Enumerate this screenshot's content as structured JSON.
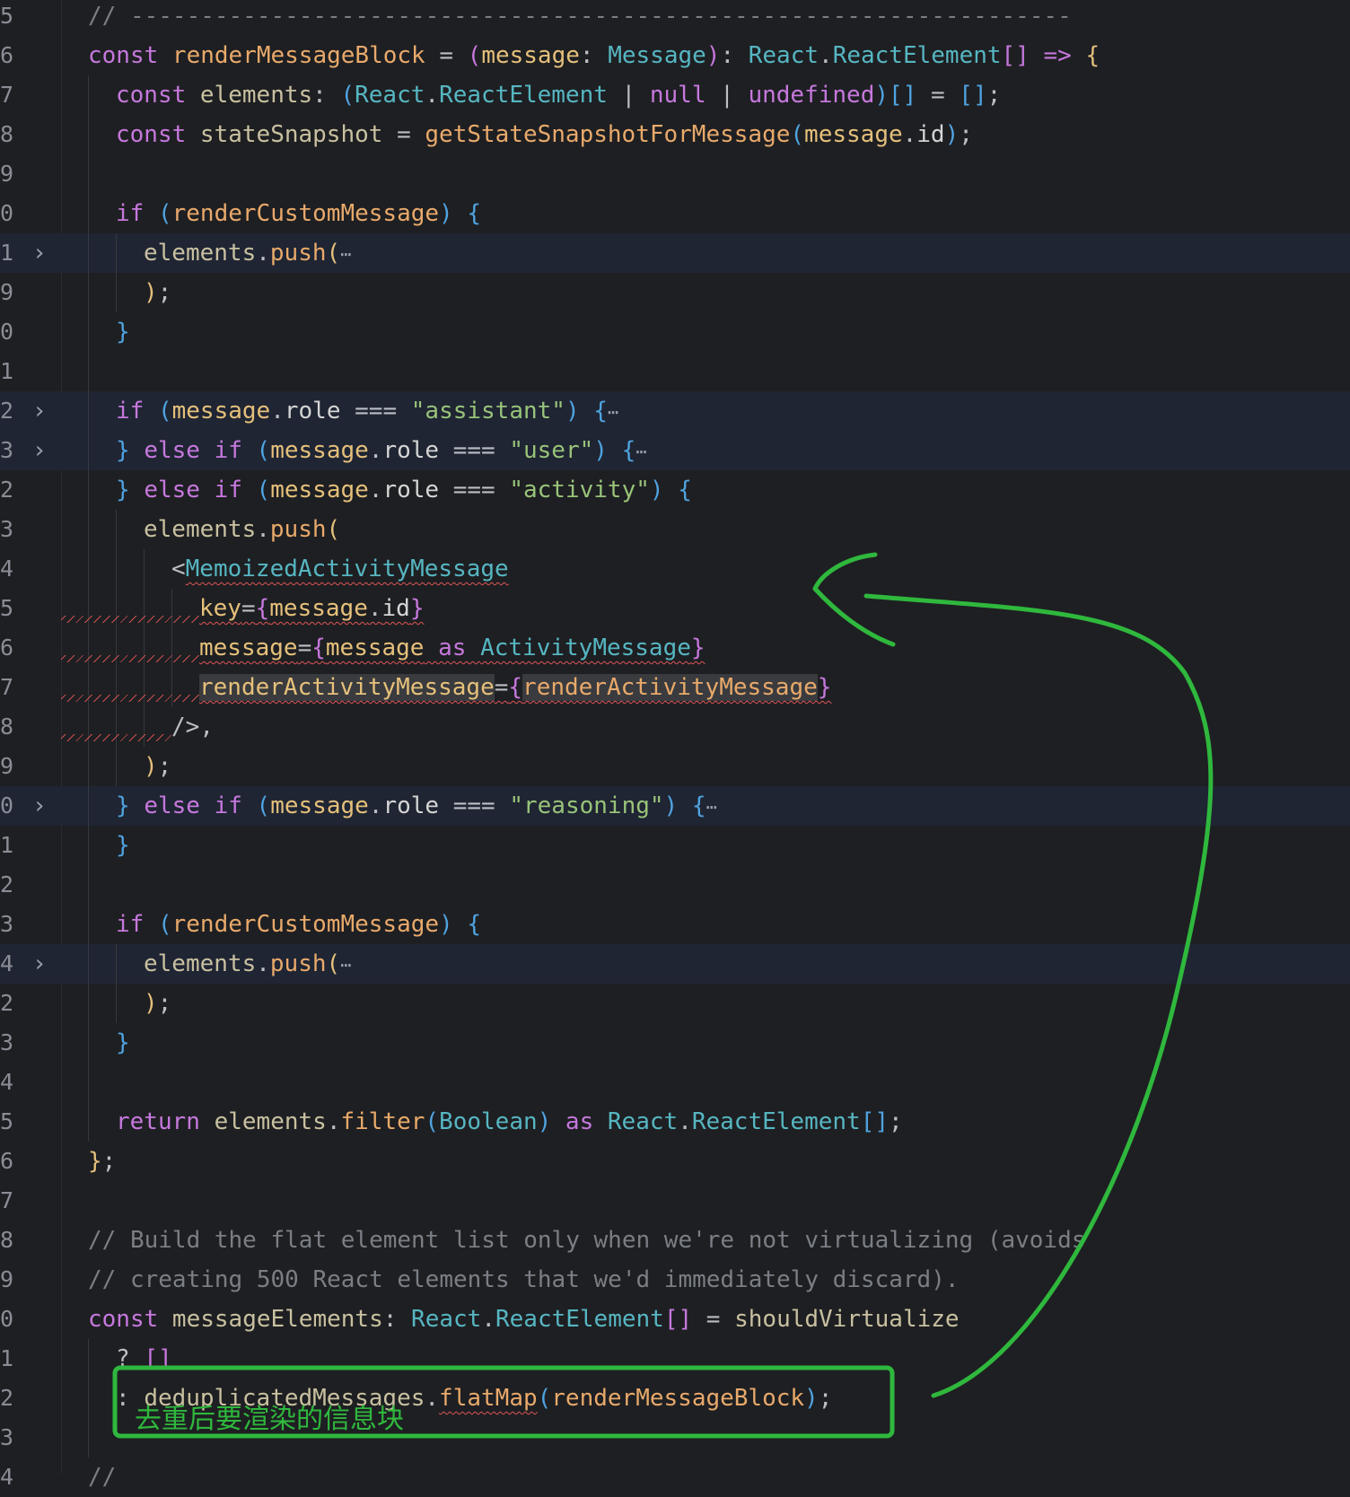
{
  "editor": {
    "lines": [
      {
        "number": "5",
        "folded": false,
        "indent": 1,
        "tokens": [
          {
            "t": "// -------------------------------------------------------------------",
            "c": "cm"
          }
        ]
      },
      {
        "number": "6",
        "folded": false,
        "indent": 1,
        "tokens": [
          {
            "t": "const ",
            "c": "kw"
          },
          {
            "t": "renderMessageBlock",
            "c": "fn"
          },
          {
            "t": " = ",
            "c": "pun"
          },
          {
            "t": "(",
            "c": "br2"
          },
          {
            "t": "message",
            "c": "attr"
          },
          {
            "t": ": ",
            "c": "pun"
          },
          {
            "t": "Message",
            "c": "ty"
          },
          {
            "t": ")",
            "c": "br2"
          },
          {
            "t": ": ",
            "c": "pun"
          },
          {
            "t": "React",
            "c": "ty"
          },
          {
            "t": ".",
            "c": "pun"
          },
          {
            "t": "ReactElement",
            "c": "ty"
          },
          {
            "t": "[]",
            "c": "br2"
          },
          {
            "t": " => ",
            "c": "kw"
          },
          {
            "t": "{",
            "c": "br1"
          }
        ]
      },
      {
        "number": "7",
        "folded": false,
        "indent": 2,
        "tokens": [
          {
            "t": "const ",
            "c": "kw"
          },
          {
            "t": "elements",
            "c": "var"
          },
          {
            "t": ": ",
            "c": "pun"
          },
          {
            "t": "(",
            "c": "br3"
          },
          {
            "t": "React",
            "c": "ty"
          },
          {
            "t": ".",
            "c": "pun"
          },
          {
            "t": "ReactElement",
            "c": "ty"
          },
          {
            "t": " | ",
            "c": "pun"
          },
          {
            "t": "null",
            "c": "kw"
          },
          {
            "t": " | ",
            "c": "pun"
          },
          {
            "t": "undefined",
            "c": "kw"
          },
          {
            "t": ")",
            "c": "br3"
          },
          {
            "t": "[]",
            "c": "br3"
          },
          {
            "t": " = ",
            "c": "pun"
          },
          {
            "t": "[]",
            "c": "br3"
          },
          {
            "t": ";",
            "c": "pun"
          }
        ]
      },
      {
        "number": "8",
        "folded": false,
        "indent": 2,
        "tokens": [
          {
            "t": "const ",
            "c": "kw"
          },
          {
            "t": "stateSnapshot",
            "c": "var"
          },
          {
            "t": " = ",
            "c": "pun"
          },
          {
            "t": "getStateSnapshotForMessage",
            "c": "fn"
          },
          {
            "t": "(",
            "c": "br3"
          },
          {
            "t": "message",
            "c": "attr"
          },
          {
            "t": ".",
            "c": "pun"
          },
          {
            "t": "id",
            "c": "prop"
          },
          {
            "t": ")",
            "c": "br3"
          },
          {
            "t": ";",
            "c": "pun"
          }
        ]
      },
      {
        "number": "9",
        "folded": false,
        "indent": 2,
        "tokens": []
      },
      {
        "number": "0",
        "folded": false,
        "indent": 2,
        "tokens": [
          {
            "t": "if ",
            "c": "kw"
          },
          {
            "t": "(",
            "c": "br3"
          },
          {
            "t": "renderCustomMessage",
            "c": "fn"
          },
          {
            "t": ")",
            "c": "br3"
          },
          {
            "t": " {",
            "c": "br3"
          }
        ]
      },
      {
        "number": "1",
        "folded": true,
        "indent": 3,
        "tokens": [
          {
            "t": "elements",
            "c": "var"
          },
          {
            "t": ".",
            "c": "pun"
          },
          {
            "t": "push",
            "c": "fn"
          },
          {
            "t": "(",
            "c": "br1"
          },
          {
            "t": "⋯",
            "c": "dots"
          }
        ]
      },
      {
        "number": "9",
        "folded": false,
        "indent": 3,
        "tokens": [
          {
            "t": ")",
            "c": "br1"
          },
          {
            "t": ";",
            "c": "pun"
          }
        ]
      },
      {
        "number": "0",
        "folded": false,
        "indent": 2,
        "tokens": [
          {
            "t": "}",
            "c": "br3"
          }
        ]
      },
      {
        "number": "1",
        "folded": false,
        "indent": 2,
        "tokens": []
      },
      {
        "number": "2",
        "folded": true,
        "indent": 2,
        "tokens": [
          {
            "t": "if ",
            "c": "kw"
          },
          {
            "t": "(",
            "c": "br3"
          },
          {
            "t": "message",
            "c": "attr"
          },
          {
            "t": ".",
            "c": "pun"
          },
          {
            "t": "role",
            "c": "prop"
          },
          {
            "t": " === ",
            "c": "pun"
          },
          {
            "t": "\"assistant\"",
            "c": "str"
          },
          {
            "t": ")",
            "c": "br3"
          },
          {
            "t": " {",
            "c": "br3"
          },
          {
            "t": "⋯",
            "c": "dots"
          }
        ]
      },
      {
        "number": "3",
        "folded": true,
        "indent": 2,
        "tokens": [
          {
            "t": "} ",
            "c": "br3"
          },
          {
            "t": "else if ",
            "c": "kw"
          },
          {
            "t": "(",
            "c": "br3"
          },
          {
            "t": "message",
            "c": "attr"
          },
          {
            "t": ".",
            "c": "pun"
          },
          {
            "t": "role",
            "c": "prop"
          },
          {
            "t": " === ",
            "c": "pun"
          },
          {
            "t": "\"user\"",
            "c": "str"
          },
          {
            "t": ")",
            "c": "br3"
          },
          {
            "t": " {",
            "c": "br3"
          },
          {
            "t": "⋯",
            "c": "dots"
          }
        ]
      },
      {
        "number": "2",
        "folded": false,
        "indent": 2,
        "tokens": [
          {
            "t": "} ",
            "c": "br3"
          },
          {
            "t": "else if ",
            "c": "kw"
          },
          {
            "t": "(",
            "c": "br3"
          },
          {
            "t": "message",
            "c": "attr"
          },
          {
            "t": ".",
            "c": "pun"
          },
          {
            "t": "role",
            "c": "prop"
          },
          {
            "t": " === ",
            "c": "pun"
          },
          {
            "t": "\"activity\"",
            "c": "str"
          },
          {
            "t": ")",
            "c": "br3"
          },
          {
            "t": " {",
            "c": "br3"
          }
        ]
      },
      {
        "number": "3",
        "folded": false,
        "indent": 3,
        "tokens": [
          {
            "t": "elements",
            "c": "var"
          },
          {
            "t": ".",
            "c": "pun"
          },
          {
            "t": "push",
            "c": "fn"
          },
          {
            "t": "(",
            "c": "br1"
          }
        ]
      },
      {
        "number": "4",
        "folded": false,
        "indent": 4,
        "tokens": [
          {
            "t": "<",
            "c": "pun"
          },
          {
            "t": "MemoizedActivityMessage",
            "c": "ty",
            "sq": true
          }
        ]
      },
      {
        "number": "5",
        "folded": false,
        "indent": 5,
        "sqlead": true,
        "tokens": [
          {
            "t": "key",
            "c": "attr",
            "sq": true
          },
          {
            "t": "=",
            "c": "pun",
            "sq": true
          },
          {
            "t": "{",
            "c": "br2",
            "sq": true
          },
          {
            "t": "message",
            "c": "attr",
            "sq": true
          },
          {
            "t": ".",
            "c": "pun",
            "sq": true
          },
          {
            "t": "id",
            "c": "prop",
            "sq": true
          },
          {
            "t": "}",
            "c": "br2",
            "sq": true
          }
        ]
      },
      {
        "number": "6",
        "folded": false,
        "indent": 5,
        "sqlead": true,
        "tokens": [
          {
            "t": "message",
            "c": "attr",
            "sq": true
          },
          {
            "t": "=",
            "c": "pun",
            "sq": true
          },
          {
            "t": "{",
            "c": "br2",
            "sq": true
          },
          {
            "t": "message",
            "c": "attr",
            "sq": true
          },
          {
            "t": " as ",
            "c": "kw",
            "sq": true
          },
          {
            "t": "ActivityMessage",
            "c": "ty",
            "sq": true
          },
          {
            "t": "}",
            "c": "br2",
            "sq": true
          }
        ]
      },
      {
        "number": "7",
        "folded": false,
        "indent": 5,
        "sqlead": true,
        "tokens": [
          {
            "t": "renderActivityMessage",
            "c": "attr",
            "sq": true,
            "hl": true
          },
          {
            "t": "=",
            "c": "pun",
            "sq": true
          },
          {
            "t": "{",
            "c": "br2",
            "sq": true
          },
          {
            "t": "renderActivityMessage",
            "c": "fn",
            "sq": true,
            "hl": true
          },
          {
            "t": "}",
            "c": "br2",
            "sq": true
          }
        ]
      },
      {
        "number": "8",
        "folded": false,
        "indent": 4,
        "sqlead": true,
        "tokens": [
          {
            "t": "/>",
            "c": "pun"
          },
          {
            "t": ",",
            "c": "pun"
          }
        ]
      },
      {
        "number": "9",
        "folded": false,
        "indent": 3,
        "tokens": [
          {
            "t": ")",
            "c": "br1"
          },
          {
            "t": ";",
            "c": "pun"
          }
        ]
      },
      {
        "number": "0",
        "folded": true,
        "indent": 2,
        "tokens": [
          {
            "t": "} ",
            "c": "br3"
          },
          {
            "t": "else if ",
            "c": "kw"
          },
          {
            "t": "(",
            "c": "br3"
          },
          {
            "t": "message",
            "c": "attr"
          },
          {
            "t": ".",
            "c": "pun"
          },
          {
            "t": "role",
            "c": "prop"
          },
          {
            "t": " === ",
            "c": "pun"
          },
          {
            "t": "\"reasoning\"",
            "c": "str"
          },
          {
            "t": ")",
            "c": "br3"
          },
          {
            "t": " {",
            "c": "br3"
          },
          {
            "t": "⋯",
            "c": "dots"
          }
        ]
      },
      {
        "number": "1",
        "folded": false,
        "indent": 2,
        "tokens": [
          {
            "t": "}",
            "c": "br3"
          }
        ]
      },
      {
        "number": "2",
        "folded": false,
        "indent": 2,
        "tokens": []
      },
      {
        "number": "3",
        "folded": false,
        "indent": 2,
        "tokens": [
          {
            "t": "if ",
            "c": "kw"
          },
          {
            "t": "(",
            "c": "br3"
          },
          {
            "t": "renderCustomMessage",
            "c": "fn"
          },
          {
            "t": ")",
            "c": "br3"
          },
          {
            "t": " {",
            "c": "br3"
          }
        ]
      },
      {
        "number": "4",
        "folded": true,
        "indent": 3,
        "tokens": [
          {
            "t": "elements",
            "c": "var"
          },
          {
            "t": ".",
            "c": "pun"
          },
          {
            "t": "push",
            "c": "fn"
          },
          {
            "t": "(",
            "c": "br1"
          },
          {
            "t": "⋯",
            "c": "dots"
          }
        ]
      },
      {
        "number": "2",
        "folded": false,
        "indent": 3,
        "tokens": [
          {
            "t": ")",
            "c": "br1"
          },
          {
            "t": ";",
            "c": "pun"
          }
        ]
      },
      {
        "number": "3",
        "folded": false,
        "indent": 2,
        "tokens": [
          {
            "t": "}",
            "c": "br3"
          }
        ]
      },
      {
        "number": "4",
        "folded": false,
        "indent": 2,
        "tokens": []
      },
      {
        "number": "5",
        "folded": false,
        "indent": 2,
        "tokens": [
          {
            "t": "return ",
            "c": "kw"
          },
          {
            "t": "elements",
            "c": "var"
          },
          {
            "t": ".",
            "c": "pun"
          },
          {
            "t": "filter",
            "c": "fn"
          },
          {
            "t": "(",
            "c": "br3"
          },
          {
            "t": "Boolean",
            "c": "ty"
          },
          {
            "t": ")",
            "c": "br3"
          },
          {
            "t": " as ",
            "c": "kw"
          },
          {
            "t": "React",
            "c": "ty"
          },
          {
            "t": ".",
            "c": "pun"
          },
          {
            "t": "ReactElement",
            "c": "ty"
          },
          {
            "t": "[]",
            "c": "br3"
          },
          {
            "t": ";",
            "c": "pun"
          }
        ]
      },
      {
        "number": "6",
        "folded": false,
        "indent": 1,
        "tokens": [
          {
            "t": "}",
            "c": "br1"
          },
          {
            "t": ";",
            "c": "pun"
          }
        ]
      },
      {
        "number": "7",
        "folded": false,
        "indent": 1,
        "tokens": []
      },
      {
        "number": "8",
        "folded": false,
        "indent": 1,
        "tokens": [
          {
            "t": "// Build the flat element list only when we're not virtualizing (avoids",
            "c": "cm"
          }
        ]
      },
      {
        "number": "9",
        "folded": false,
        "indent": 1,
        "tokens": [
          {
            "t": "// creating 500 React elements that we'd immediately discard).",
            "c": "cm"
          }
        ]
      },
      {
        "number": "0",
        "folded": false,
        "indent": 1,
        "tokens": [
          {
            "t": "const ",
            "c": "kw"
          },
          {
            "t": "messageElements",
            "c": "var"
          },
          {
            "t": ": ",
            "c": "pun"
          },
          {
            "t": "React",
            "c": "ty"
          },
          {
            "t": ".",
            "c": "pun"
          },
          {
            "t": "ReactElement",
            "c": "ty"
          },
          {
            "t": "[]",
            "c": "br2"
          },
          {
            "t": " = ",
            "c": "pun"
          },
          {
            "t": "shouldVirtualize",
            "c": "var"
          }
        ]
      },
      {
        "number": "1",
        "folded": false,
        "indent": 2,
        "tokens": [
          {
            "t": "? ",
            "c": "pun"
          },
          {
            "t": "[]",
            "c": "br2"
          }
        ]
      },
      {
        "number": "2",
        "folded": false,
        "indent": 2,
        "tokens": [
          {
            "t": ": ",
            "c": "pun"
          },
          {
            "t": "deduplicatedMessages",
            "c": "var"
          },
          {
            "t": ".",
            "c": "pun"
          },
          {
            "t": "flatMap",
            "c": "fn",
            "sq": true
          },
          {
            "t": "(",
            "c": "br3"
          },
          {
            "t": "renderMessageBlock",
            "c": "fn"
          },
          {
            "t": ")",
            "c": "br3"
          },
          {
            "t": ";",
            "c": "pun"
          }
        ]
      },
      {
        "number": "3",
        "folded": false,
        "indent": 2,
        "tokens": []
      },
      {
        "number": "4",
        "folded": false,
        "indent": 1,
        "tokens": [
          {
            "t": "//",
            "c": "cm"
          }
        ]
      }
    ]
  },
  "annotation": {
    "label": "去重后要渲染的信息块",
    "color": "#2fb83d"
  },
  "icons": {
    "fold": "chevron-right-icon"
  }
}
